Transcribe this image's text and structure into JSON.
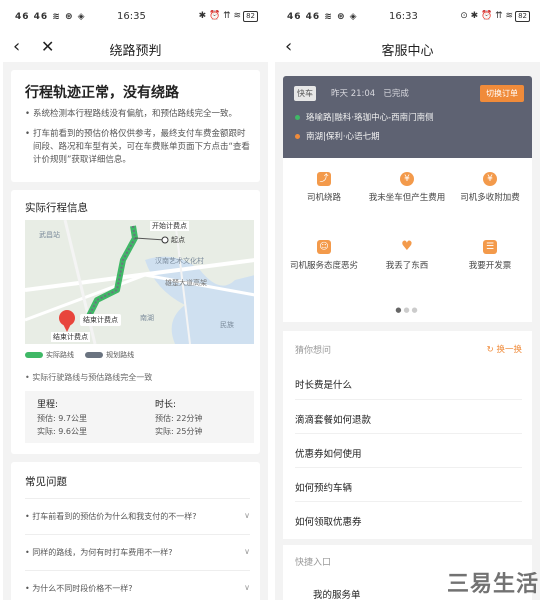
{
  "left": {
    "status": {
      "signal": "46 46 ≋ ⊛ ◈",
      "time": "16:35",
      "icons": "✱ ⏰ ⇈ ≋",
      "battery": "82"
    },
    "nav": {
      "title": "绕路预判"
    },
    "summary": {
      "heading": "行程轨迹正常，没有绕路",
      "points": [
        "系统检测本行程路线没有偏航，和预估路线完全一致。",
        "打车前看到的预估价格仅供参考，最终支付车费金额跟时间段、路况和车型有关，可在车费账单页面下方点击“查看计价规则”获取详细信息。"
      ]
    },
    "trip": {
      "title": "实际行程信息",
      "map_labels": {
        "start_fee": "开始计费点",
        "start": "起点",
        "end_fee": "结束计费点",
        "end": "结束计费点",
        "place1": "武昌站",
        "place2": "汉南艺术文化村",
        "road": "雄楚大道高架",
        "lake": "南湖",
        "place3": "南湖",
        "place4": "民族"
      },
      "legend": {
        "actual": "实际路线",
        "planned": "规划路线"
      },
      "note": "实际行驶路线与预估路线完全一致",
      "mileage": {
        "label": "里程:",
        "est": "预估: 9.7公里",
        "act": "实际: 9.6公里"
      },
      "duration": {
        "label": "时长:",
        "est": "预估: 22分钟",
        "act": "实际: 25分钟"
      }
    },
    "faq": {
      "title": "常见问题",
      "items": [
        "打车前看到的预估价为什么和我支付的不一样?",
        "同样的路线，为何有时打车费用不一样?",
        "为什么不同时段价格不一样?"
      ]
    },
    "colors": {
      "actual": "#3fb866",
      "planned": "#6a7380",
      "marker": "#e8453c"
    }
  },
  "right": {
    "status": {
      "signal": "46 46 ≋ ⊛ ◈",
      "time": "16:33",
      "icons": "⊙ ✱ ⏰ ⇈ ≋",
      "battery": "82"
    },
    "nav": {
      "title": "客服中心"
    },
    "order": {
      "tag": "快车",
      "time": "昨天 21:04",
      "state": "已完成",
      "switch": "切换订单",
      "from": "珞喻路|融科·珞珈中心-西南门南侧",
      "to": "南湖|保利·心语七期"
    },
    "issues": [
      {
        "icon": "⤴",
        "label": "司机绕路"
      },
      {
        "icon": "¥",
        "label": "我未坐车但产生费用"
      },
      {
        "icon": "¥",
        "label": "司机多收附加费"
      },
      {
        "icon": "☺",
        "label": "司机服务态度恶劣"
      },
      {
        "icon": "♥",
        "label": "我丢了东西"
      },
      {
        "icon": "☰",
        "label": "我要开发票"
      }
    ],
    "guess": {
      "title": "猜你想问",
      "refresh": "换一换",
      "items": [
        "时长费是什么",
        "滴滴套餐如何退款",
        "优惠券如何使用",
        "如何预约车辆",
        "如何领取优惠券"
      ]
    },
    "quick": {
      "title": "快捷入口",
      "item": "我的服务单"
    },
    "accent": "#f08b3a"
  },
  "watermark": "三易生活"
}
